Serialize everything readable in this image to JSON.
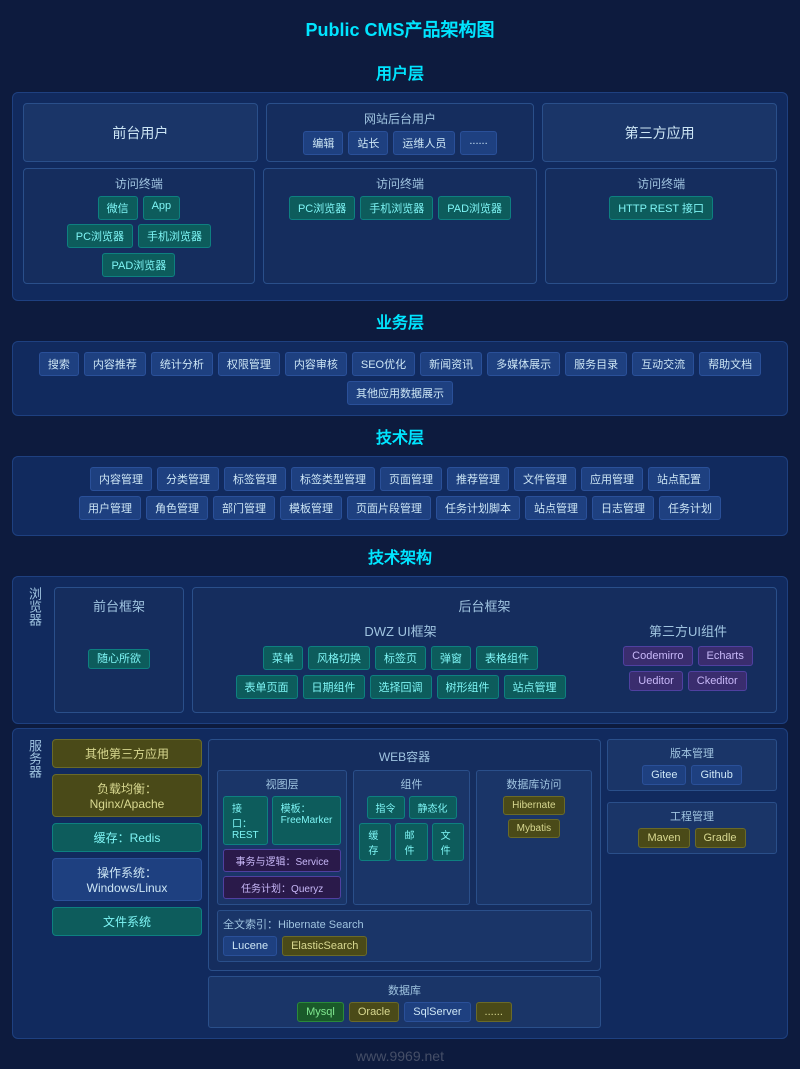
{
  "title": "Public CMS产品架构图",
  "layers": {
    "user": "用户层",
    "business": "业务层",
    "tech": "技术层",
    "arch": "技术架构"
  },
  "userLayer": {
    "frontUser": "前台用户",
    "siteBackUser": "网站后台用户",
    "thirdParty": "第三方应用",
    "siteBackRoles": [
      "编辑",
      "站长",
      "运维人员",
      "......"
    ],
    "frontTerminal": "访问终端",
    "frontTerminalItems": [
      "微信",
      "App"
    ],
    "frontTerminalItems2": [
      "PC浏览器",
      "手机浏览器",
      "PAD浏览器"
    ],
    "midTerminal": "访问终端",
    "midTerminalItems": [
      "PC浏览器",
      "手机浏览器",
      "PAD浏览器"
    ],
    "rightTerminal": "访问终端",
    "rightTerminalItems": [
      "HTTP REST 接口"
    ]
  },
  "businessLayer": {
    "items": [
      "搜索",
      "内容推荐",
      "统计分析",
      "权限管理",
      "内容审核",
      "SEO优化",
      "新闻资讯",
      "多媒体展示",
      "服务目录",
      "互动交流",
      "帮助文档",
      "其他应用数据展示"
    ]
  },
  "techLayer": {
    "row1": [
      "内容管理",
      "分类管理",
      "标签管理",
      "标签类型管理",
      "页面管理",
      "推荐管理",
      "文件管理",
      "应用管理",
      "站点配置"
    ],
    "row2": [
      "用户管理",
      "角色管理",
      "部门管理",
      "模板管理",
      "页面片段管理",
      "任务计划脚本",
      "站点管理",
      "日志管理",
      "任务计划"
    ]
  },
  "techArch": {
    "browserLabel": "浏览器",
    "frontFramework": "前台框架",
    "backFramework": "后台框架",
    "suixin": "随心所欲",
    "dwzUI": "DWZ UI框架",
    "dwzRow1": [
      "菜单",
      "风格切换",
      "标签页",
      "弹窗",
      "表格组件"
    ],
    "dwzRow2": [
      "表单页面",
      "日期组件",
      "选择回调",
      "树形组件",
      "站点管理"
    ],
    "thirdPartyUI": "第三方UI组件",
    "thirdPartyRow1": [
      "Codemirro",
      "Echarts"
    ],
    "thirdPartyRow2": [
      "Ueditor",
      "Ckeditor"
    ],
    "serverLabel": "服务器",
    "otherThirdParty": "其他第三方应用",
    "loadBalance": "负载均衡：Nginx/Apache",
    "cache": "缓存：Redis",
    "osLabel": "操作系统：Windows/Linux",
    "fileSystem": "文件系统",
    "webContainer": "WEB容器",
    "viewLayer": "视图层",
    "serviceLabel": "事务与逻辑：Service",
    "queryzLabel": "任务计划：Queryz",
    "interfaceRest": "接口：REST",
    "templateFM": "模板：FreeMarker",
    "componentLabel": "组件",
    "compRow1": [
      "指令",
      "静态化"
    ],
    "compRow2": [
      "缓存",
      "邮件",
      "文件"
    ],
    "dbAccess": "数据库访问",
    "hibernateLabel": "Hibernate",
    "mybatisLabel": "Mybatis",
    "versionMgmt": "版本管理",
    "gitee": "Gitee",
    "github": "Github",
    "projectMgmt": "工程管理",
    "maven": "Maven",
    "gradle": "Gradle",
    "fulltextLabel": "全文索引：Hibernate Search",
    "lucene": "Lucene",
    "elasticsearch": "ElasticSearch",
    "dbLabel": "数据库",
    "mysql": "Mysql",
    "oracle": "Oracle",
    "sqlserver": "SqlServer",
    "dbDots": "......"
  },
  "watermark": "www.9969.net"
}
